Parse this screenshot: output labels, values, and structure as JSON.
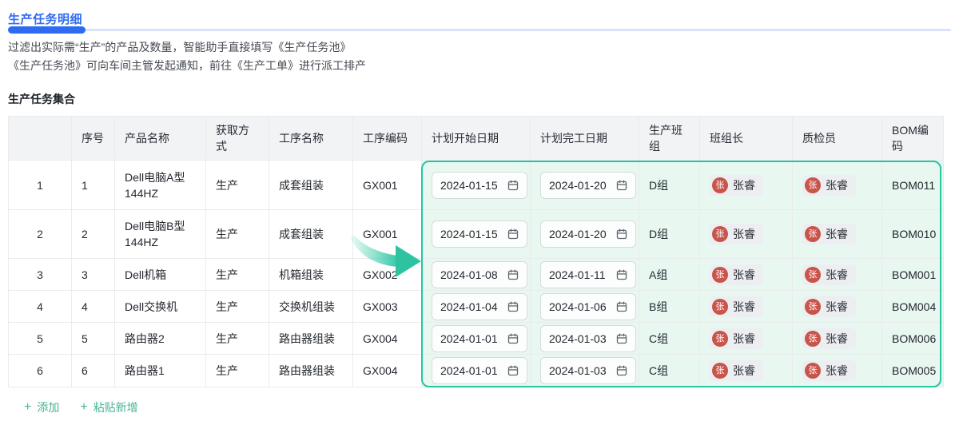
{
  "page": {
    "title": "生产任务明细",
    "desc_line1": "过滤出实际需“生产”的产品及数量，智能助手直接填写《生产任务池》",
    "desc_line2": "《生产任务池》可向车间主管发起通知，前往《生产工单》进行派工排产",
    "section_title": "生产任务集合"
  },
  "table": {
    "columns": [
      "",
      "序号",
      "产品名称",
      "获取方式",
      "工序名称",
      "工序编码",
      "计划开始日期",
      "计划完工日期",
      "生产班组",
      "班组长",
      "质检员",
      "BOM编码"
    ],
    "rows": [
      {
        "index": "1",
        "seq": "1",
        "product": "Dell电脑A型 144HZ",
        "acquire": "生产",
        "process": "成套组装",
        "process_code": "GX001",
        "start_date": "2024-01-15",
        "end_date": "2024-01-20",
        "team": "D组",
        "leader_avatar": "张",
        "leader": "张睿",
        "inspector_avatar": "张",
        "inspector": "张睿",
        "bom": "BOM011"
      },
      {
        "index": "2",
        "seq": "2",
        "product": "Dell电脑B型 144HZ",
        "acquire": "生产",
        "process": "成套组装",
        "process_code": "GX001",
        "start_date": "2024-01-15",
        "end_date": "2024-01-20",
        "team": "D组",
        "leader_avatar": "张",
        "leader": "张睿",
        "inspector_avatar": "张",
        "inspector": "张睿",
        "bom": "BOM010"
      },
      {
        "index": "3",
        "seq": "3",
        "product": "Dell机箱",
        "acquire": "生产",
        "process": "机箱组装",
        "process_code": "GX002",
        "start_date": "2024-01-08",
        "end_date": "2024-01-11",
        "team": "A组",
        "leader_avatar": "张",
        "leader": "张睿",
        "inspector_avatar": "张",
        "inspector": "张睿",
        "bom": "BOM001"
      },
      {
        "index": "4",
        "seq": "4",
        "product": "Dell交换机",
        "acquire": "生产",
        "process": "交换机组装",
        "process_code": "GX003",
        "start_date": "2024-01-04",
        "end_date": "2024-01-06",
        "team": "B组",
        "leader_avatar": "张",
        "leader": "张睿",
        "inspector_avatar": "张",
        "inspector": "张睿",
        "bom": "BOM004"
      },
      {
        "index": "5",
        "seq": "5",
        "product": "路由器2",
        "acquire": "生产",
        "process": "路由器组装",
        "process_code": "GX004",
        "start_date": "2024-01-01",
        "end_date": "2024-01-03",
        "team": "C组",
        "leader_avatar": "张",
        "leader": "张睿",
        "inspector_avatar": "张",
        "inspector": "张睿",
        "bom": "BOM006"
      },
      {
        "index": "6",
        "seq": "6",
        "product": "路由器1",
        "acquire": "生产",
        "process": "路由器组装",
        "process_code": "GX004",
        "start_date": "2024-01-01",
        "end_date": "2024-01-03",
        "team": "C组",
        "leader_avatar": "张",
        "leader": "张睿",
        "inspector_avatar": "张",
        "inspector": "张睿",
        "bom": "BOM005"
      }
    ]
  },
  "footer": {
    "add_label": "添加",
    "paste_label": "粘贴新增",
    "plus_glyph": "+"
  },
  "colors": {
    "accent_blue": "#2E6BF2",
    "accent_green": "#27C6A0",
    "highlight_bg": "#E9F7F1",
    "avatar_red": "#C8544A"
  }
}
